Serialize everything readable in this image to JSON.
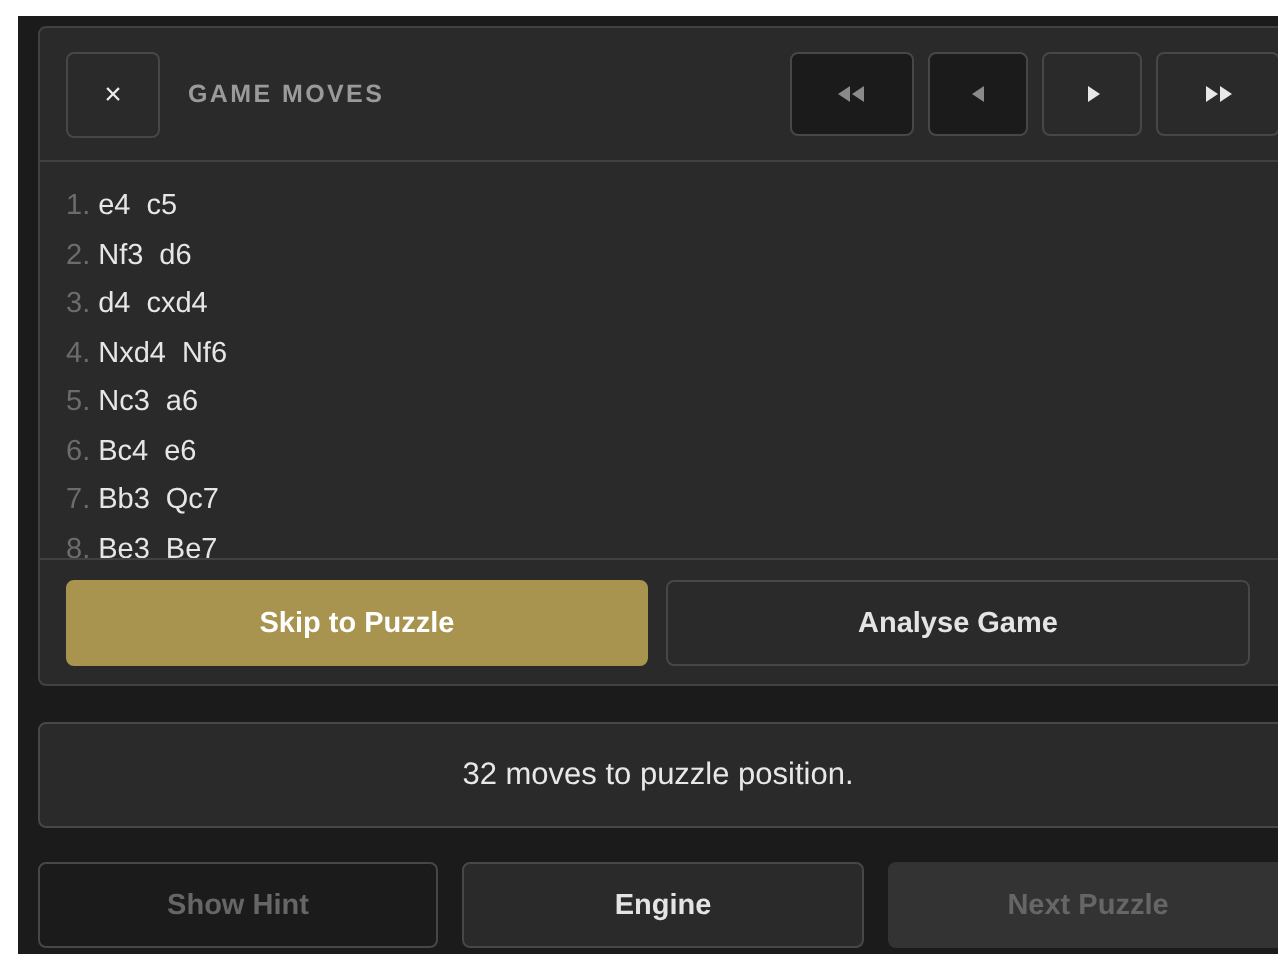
{
  "panel": {
    "close": "×",
    "title": "GAME MOVES",
    "nav": [
      {
        "kind": "first",
        "disabled": true
      },
      {
        "kind": "prev",
        "disabled": true
      },
      {
        "kind": "next",
        "disabled": false
      },
      {
        "kind": "last",
        "disabled": false
      }
    ],
    "moves": [
      {
        "number": "1.",
        "white": "e4",
        "black": "c5"
      },
      {
        "number": "2.",
        "white": "Nf3",
        "black": "d6"
      },
      {
        "number": "3.",
        "white": "d4",
        "black": "cxd4"
      },
      {
        "number": "4.",
        "white": "Nxd4",
        "black": "Nf6"
      },
      {
        "number": "5.",
        "white": "Nc3",
        "black": "a6"
      },
      {
        "number": "6.",
        "white": "Bc4",
        "black": "e6"
      },
      {
        "number": "7.",
        "white": "Bb3",
        "black": "Qc7"
      },
      {
        "number": "8.",
        "white": "Be3",
        "black": "Be7"
      }
    ],
    "actions": [
      {
        "label": "Skip to Puzzle",
        "kind": "primary",
        "disabled": false
      },
      {
        "label": "Analyse Game",
        "kind": "outline",
        "disabled": false
      }
    ]
  },
  "status": "32 moves to puzzle position.",
  "buttons": [
    {
      "label": "Show Hint",
      "kind": "outline",
      "disabled": true
    },
    {
      "label": "Engine",
      "kind": "solid",
      "disabled": false
    },
    {
      "label": "Next Puzzle",
      "kind": "solid",
      "disabled": true
    }
  ]
}
